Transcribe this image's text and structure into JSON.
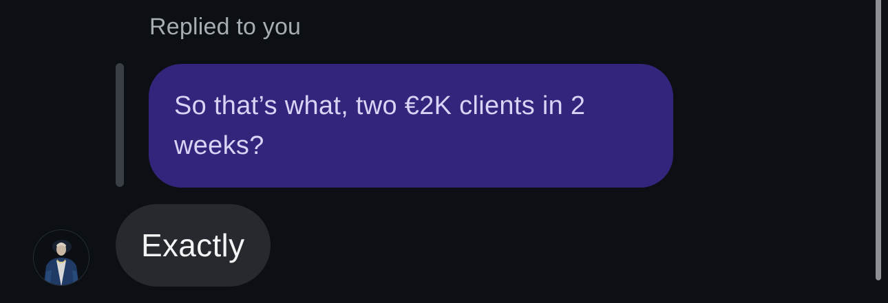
{
  "thread": {
    "reply_label": "Replied to you",
    "quoted_message": "So that’s what, two €2K clients in 2 weeks?",
    "message": "Exactly"
  },
  "avatar": {
    "icon": "user-avatar-icon"
  },
  "colors": {
    "background": "#0c1014",
    "quoted_bubble": "#33257c",
    "quoted_text": "#d9d3f5",
    "message_bubble": "#26292d",
    "message_text": "#f3f4f6",
    "reply_label": "#a8adb3"
  }
}
